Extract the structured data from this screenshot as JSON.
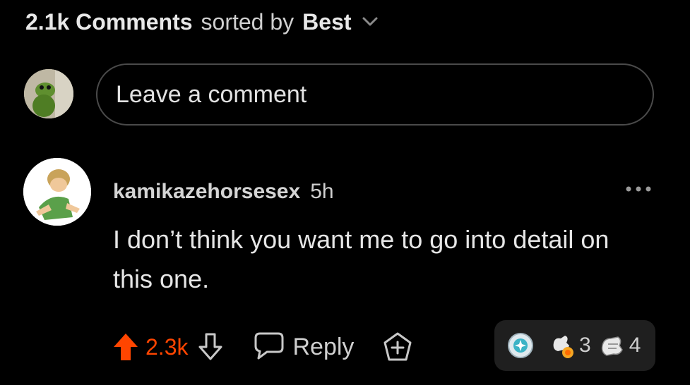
{
  "header": {
    "count_label": "2.1k Comments",
    "sorted_label": "sorted by",
    "sort_value": "Best",
    "chevron_icon": "chevron-down-icon"
  },
  "composer": {
    "placeholder": "Leave a comment"
  },
  "comment": {
    "username": "kamikazehorsesex",
    "age": "5h",
    "text": "I don’t think you want me to go into detail on this one.",
    "score": "2.3k",
    "reply_label": "Reply",
    "awards": [
      {
        "icon": "silver-award-icon",
        "count": ""
      },
      {
        "icon": "wholesome-award-icon",
        "count": "3"
      },
      {
        "icon": "bless-up-award-icon",
        "count": "4"
      }
    ]
  },
  "colors": {
    "background": "#000000",
    "upvote": "#ff4500",
    "text": "#d7dadc",
    "border": "#4a4a4a"
  }
}
